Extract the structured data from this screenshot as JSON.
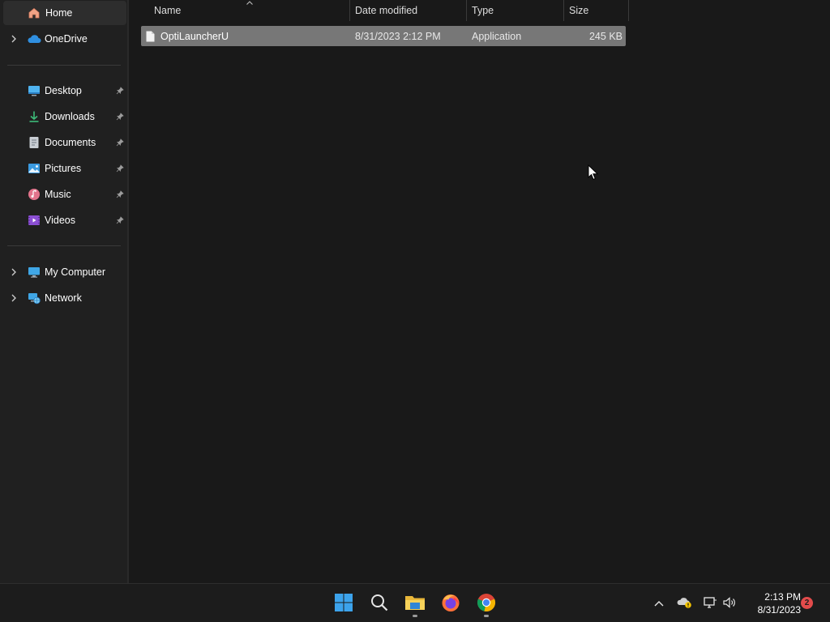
{
  "sidebar": {
    "home": {
      "label": "Home",
      "icon": "home-icon"
    },
    "onedrive": {
      "label": "OneDrive",
      "icon": "cloud-icon"
    },
    "quick_access": [
      {
        "label": "Desktop",
        "icon": "desktop-icon",
        "pinned": true
      },
      {
        "label": "Downloads",
        "icon": "download-icon",
        "pinned": true
      },
      {
        "label": "Documents",
        "icon": "document-icon",
        "pinned": true
      },
      {
        "label": "Pictures",
        "icon": "picture-icon",
        "pinned": true
      },
      {
        "label": "Music",
        "icon": "music-icon",
        "pinned": true
      },
      {
        "label": "Videos",
        "icon": "video-icon",
        "pinned": true
      }
    ],
    "my_computer": {
      "label": "My Computer",
      "icon": "computer-icon"
    },
    "network": {
      "label": "Network",
      "icon": "network-icon"
    }
  },
  "columns": {
    "name": "Name",
    "date_modified": "Date modified",
    "type": "Type",
    "size": "Size"
  },
  "files": [
    {
      "name": "OptiLauncherU",
      "date_modified": "8/31/2023 2:12 PM",
      "type": "Application",
      "size": "245 KB",
      "selected": true
    }
  ],
  "taskbar": {
    "apps": [
      "start-icon",
      "search-icon",
      "file-explorer-icon",
      "firefox-icon",
      "chrome-icon"
    ],
    "clock_time": "2:13 PM",
    "clock_date": "8/31/2023",
    "notification_count": "2"
  },
  "colors": {
    "background": "#191919",
    "sidebar": "#202020",
    "selection": "#777777",
    "taskbar": "#1c1c1c",
    "badge": "#e24b4b"
  }
}
